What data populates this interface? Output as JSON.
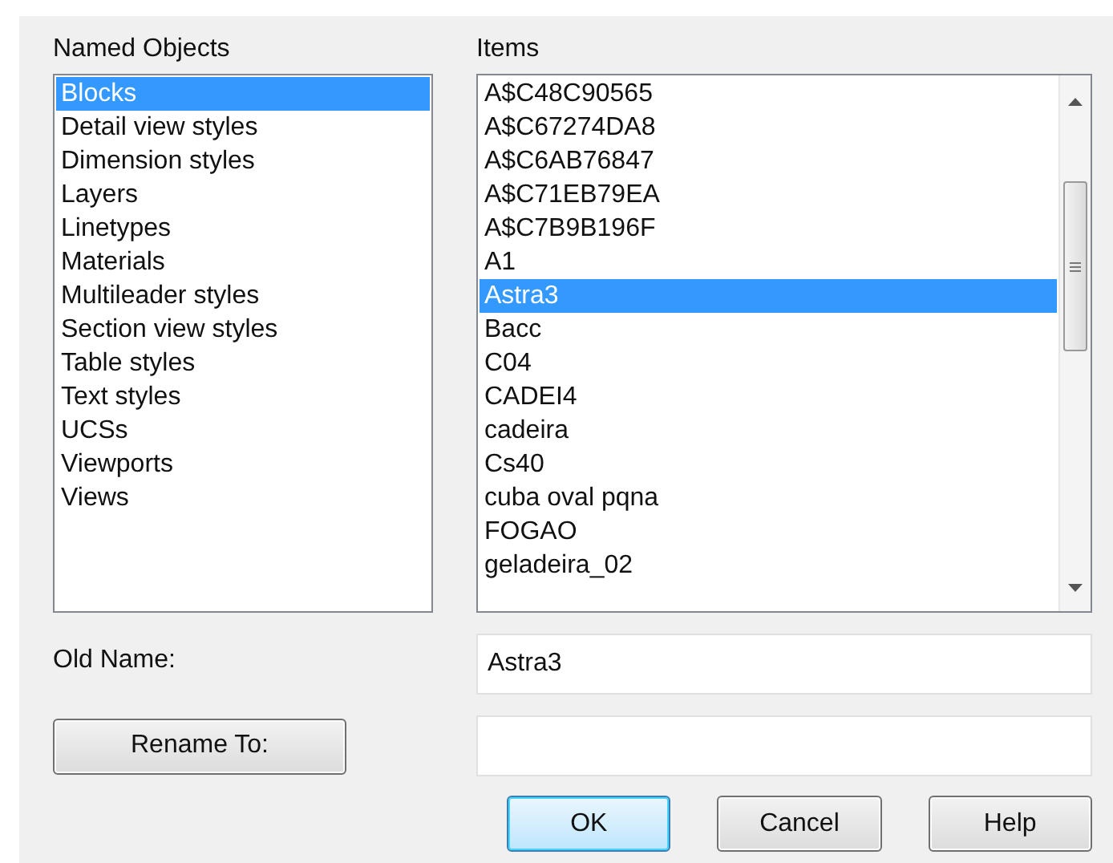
{
  "named_objects": {
    "label": "Named Objects",
    "items": [
      {
        "label": "Blocks",
        "selected": true
      },
      {
        "label": "Detail view styles",
        "selected": false
      },
      {
        "label": "Dimension styles",
        "selected": false
      },
      {
        "label": "Layers",
        "selected": false
      },
      {
        "label": "Linetypes",
        "selected": false
      },
      {
        "label": "Materials",
        "selected": false
      },
      {
        "label": "Multileader styles",
        "selected": false
      },
      {
        "label": "Section view styles",
        "selected": false
      },
      {
        "label": "Table styles",
        "selected": false
      },
      {
        "label": "Text styles",
        "selected": false
      },
      {
        "label": "UCSs",
        "selected": false
      },
      {
        "label": "Viewports",
        "selected": false
      },
      {
        "label": "Views",
        "selected": false
      }
    ]
  },
  "items": {
    "label": "Items",
    "items": [
      {
        "label": "A$C48C90565",
        "selected": false
      },
      {
        "label": "A$C67274DA8",
        "selected": false
      },
      {
        "label": "A$C6AB76847",
        "selected": false
      },
      {
        "label": "A$C71EB79EA",
        "selected": false
      },
      {
        "label": "A$C7B9B196F",
        "selected": false
      },
      {
        "label": "A1",
        "selected": false
      },
      {
        "label": "Astra3",
        "selected": true
      },
      {
        "label": "Bacc",
        "selected": false
      },
      {
        "label": "C04",
        "selected": false
      },
      {
        "label": "CADEI4",
        "selected": false
      },
      {
        "label": "cadeira",
        "selected": false
      },
      {
        "label": "Cs40",
        "selected": false
      },
      {
        "label": "cuba oval pqna",
        "selected": false
      },
      {
        "label": "FOGAO",
        "selected": false
      },
      {
        "label": "geladeira_02",
        "selected": false
      }
    ]
  },
  "old_name": {
    "label": "Old Name:",
    "value": "Astra3"
  },
  "rename_to": {
    "button": "Rename To:"
  },
  "buttons": [
    {
      "label": "OK",
      "kind": "default"
    },
    {
      "label": "Cancel",
      "kind": "normal"
    },
    {
      "label": "Help",
      "kind": "normal"
    }
  ]
}
